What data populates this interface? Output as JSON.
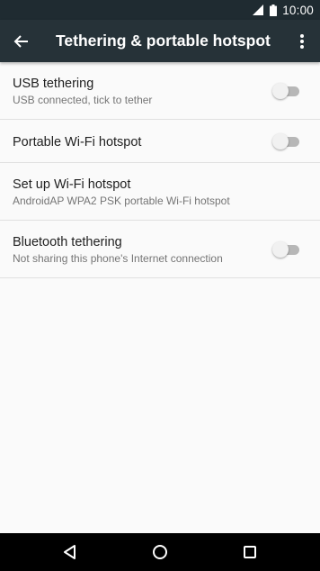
{
  "status_bar": {
    "time": "10:00",
    "icons": [
      "signal-icon",
      "battery-icon"
    ]
  },
  "app_bar": {
    "title": "Tethering & portable hotspot",
    "icons": [
      "back-arrow-icon",
      "more-vert-icon"
    ]
  },
  "items": [
    {
      "title": "USB tethering",
      "summary": "USB connected, tick to tether",
      "switch_on": false
    },
    {
      "title": "Portable Wi-Fi hotspot",
      "summary": "",
      "switch_on": false
    },
    {
      "title": "Set up Wi-Fi hotspot",
      "summary": "AndroidAP WPA2 PSK portable Wi-Fi hotspot"
    },
    {
      "title": "Bluetooth tethering",
      "summary": "Not sharing this phone's Internet connection",
      "switch_on": false
    }
  ],
  "nav_bar": {
    "icons": [
      "back-icon",
      "home-icon",
      "recents-icon"
    ]
  },
  "colors": {
    "status_bar": "#1f2b31",
    "app_bar": "#263238",
    "background": "#fafafa",
    "divider": "#e0e0e0",
    "switch_track_off": "#b7b7b7",
    "switch_thumb_off": "#f1f1f1"
  }
}
